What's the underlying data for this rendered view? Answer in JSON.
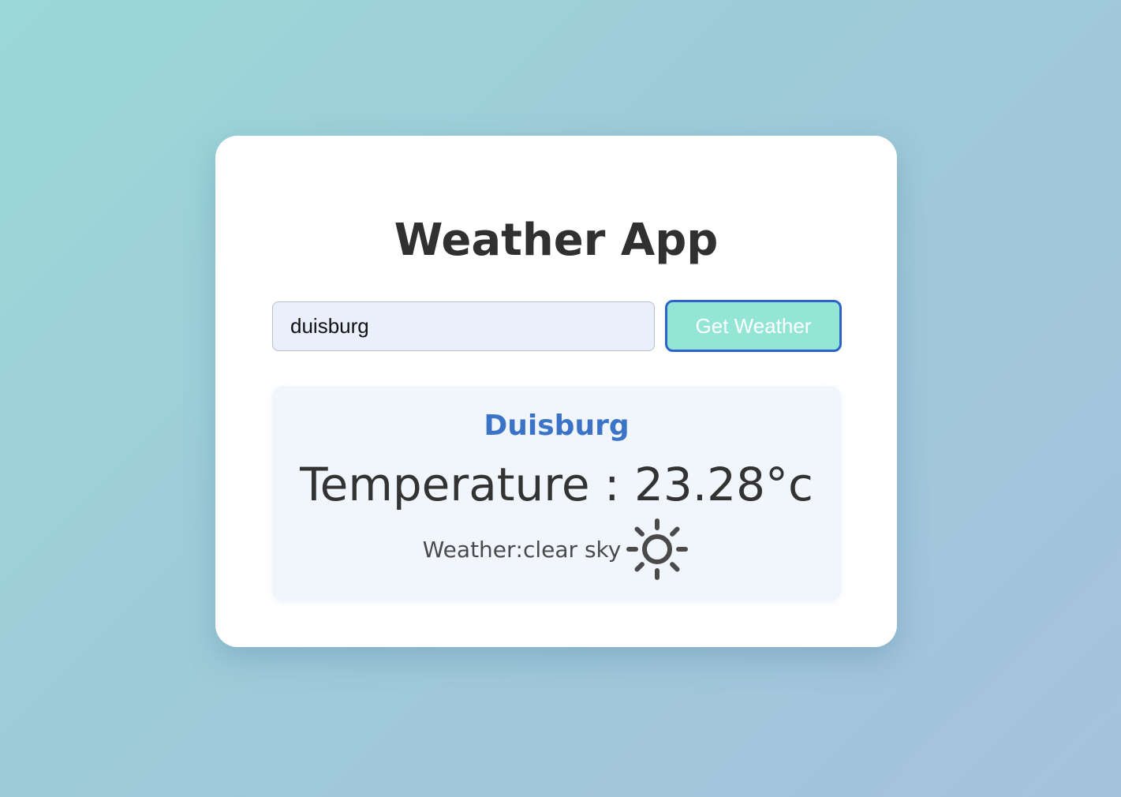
{
  "app": {
    "title": "Weather App"
  },
  "search": {
    "value": "duisburg",
    "button_label": "Get Weather"
  },
  "result": {
    "city": "Duisburg",
    "temperature_label": "Temperature",
    "separator": " : ",
    "temperature_value": "23.28",
    "temperature_unit": "°c",
    "weather_label": "Weather",
    "weather_description": "clear sky",
    "weather_icon": "sun-icon"
  },
  "colors": {
    "title_text": "#303030",
    "city_accent": "#3b73c6",
    "button_fill": "#93e6d6",
    "button_border": "#2d62c9",
    "input_fill": "#e9effb",
    "result_panel": "#f1f6fd"
  }
}
